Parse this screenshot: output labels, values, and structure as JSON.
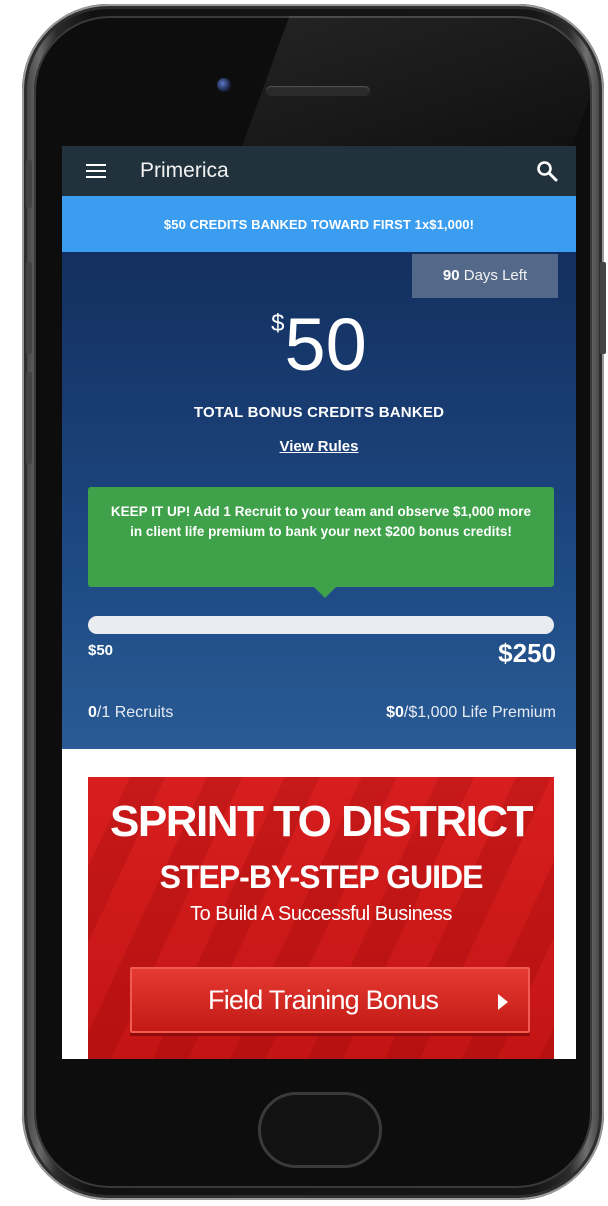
{
  "app": {
    "title": "Primerica"
  },
  "icons": {
    "menu": "hamburger-menu-icon",
    "search": "search-icon"
  },
  "banner": {
    "text": "$50 CREDITS BANKED TOWARD FIRST 1x$1,000!"
  },
  "credits": {
    "days_left_number": "90",
    "days_left_label": " Days Left",
    "currency_symbol": "$",
    "amount": "50",
    "label": "TOTAL BONUS CREDITS BANKED",
    "rules_link": "View Rules"
  },
  "tip": {
    "text": "KEEP IT UP! Add 1 Recruit to your team and observe $1,000 more in client life premium to bank your next $200 bonus credits!"
  },
  "progress": {
    "min_label": "$50",
    "max_label": "$250",
    "fraction": 0
  },
  "recruits": {
    "current": "0",
    "suffix": "/1 Recruits"
  },
  "premium": {
    "current": "$0",
    "suffix": "/$1,000 Life Premium"
  },
  "promo": {
    "title": "SPRINT TO DISTRICT",
    "subtitle": "STEP-BY-STEP GUIDE",
    "tagline": "To Build A Successful Business",
    "button_label": "Field Training Bonus"
  },
  "colors": {
    "appbar": "#22323c",
    "banner": "#3a9df0",
    "credits_panel": "#1e4a84",
    "tip": "#3fa24a",
    "promo": "#d81e1e"
  }
}
